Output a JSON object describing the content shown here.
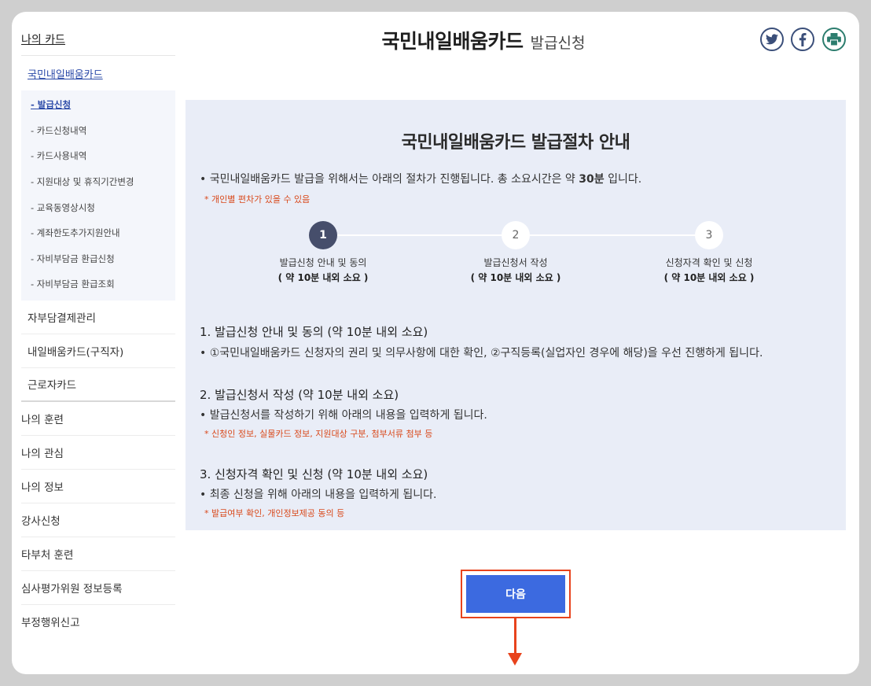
{
  "sidebar": {
    "top": "나의 카드",
    "sub1": "국민내일배움카드",
    "sub2": [
      "- 발급신청",
      "- 카드신청내역",
      "- 카드사용내역",
      "- 지원대상 및 휴직기간변경",
      "- 교육동영상시청",
      "- 계좌한도추가지원안내",
      "- 자비부담금 환급신청",
      "- 자비부담금 환급조회"
    ],
    "level1": [
      "자부담결제관리",
      "내일배움카드(구직자)",
      "근로자카드"
    ],
    "level0": [
      "나의 훈련",
      "나의 관심",
      "나의 정보",
      "강사신청",
      "타부처 훈련",
      "심사평가위원 정보등록",
      "부정행위신고"
    ]
  },
  "header": {
    "title": "국민내일배움카드",
    "subtitle": "발급신청"
  },
  "share": {
    "twitter": "twitter-icon",
    "facebook": "facebook-icon",
    "print": "print-icon"
  },
  "panel": {
    "title": "국민내일배움카드 발급절차 안내",
    "lead_bullet": "•",
    "lead_pre": "국민내일배움카드 발급을 위해서는 아래의 절차가 진행됩니다. 총 소요시간은 약 ",
    "lead_bold": "30분",
    "lead_post": " 입니다.",
    "lead_note": "* 개인별 편차가 있을 수 있음",
    "steps": [
      {
        "num": "1",
        "label": "발급신청 안내 및 동의",
        "duration": "( 약 10분 내외 소요 )"
      },
      {
        "num": "2",
        "label": "발급신청서 작성",
        "duration": "( 약 10분 내외 소요 )"
      },
      {
        "num": "3",
        "label": "신청자격 확인 및 신청",
        "duration": "( 약 10분 내외 소요 )"
      }
    ],
    "sections": [
      {
        "head": "1. 발급신청 안내 및 동의 (약 10분 내외 소요)",
        "body": "• ①국민내일배움카드 신청자의 권리 및 의무사항에 대한 확인, ②구직등록(실업자인 경우에 해당)을 우선 진행하게 됩니다.",
        "note": ""
      },
      {
        "head": "2. 발급신청서 작성 (약 10분 내외 소요)",
        "body": "• 발급신청서를 작성하기 위해 아래의 내용을 입력하게 됩니다.",
        "note": "* 신청인 정보, 실물카드 정보, 지원대상 구분, 첨부서류 첨부 등"
      },
      {
        "head": "3. 신청자격 확인 및 신청 (약 10분 내외 소요)",
        "body": "• 최종 신청을 위해 아래의 내용을 입력하게 됩니다.",
        "note": "* 발급여부 확인, 개인정보제공 동의 등"
      }
    ]
  },
  "next_button": "다음",
  "colors": {
    "accent": "#3c6ae0",
    "highlight": "#e8431c",
    "panel_bg": "#e9edf7",
    "step_active": "#464e6b"
  }
}
